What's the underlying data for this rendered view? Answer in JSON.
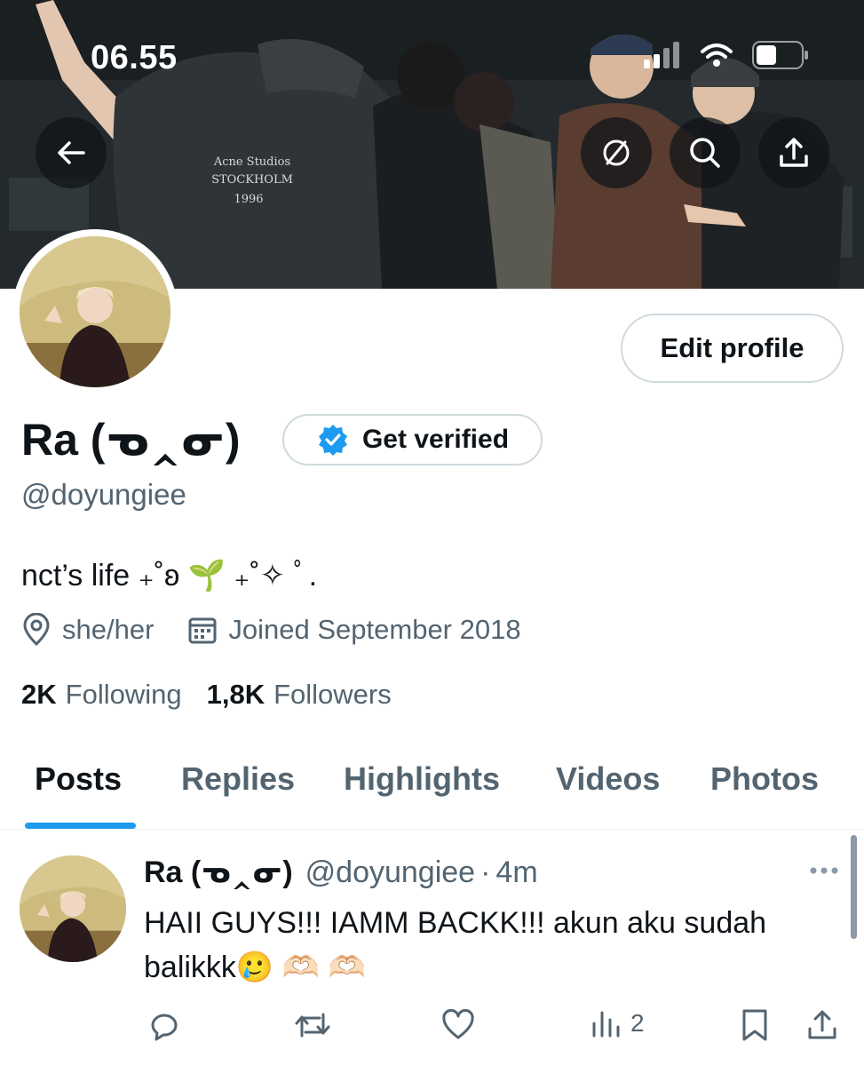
{
  "status_bar": {
    "time": "06.55"
  },
  "banner": {
    "shirt_text": [
      "Acne Studios",
      "STOCKHOLM",
      "1996"
    ]
  },
  "header_buttons": {
    "back": "arrow-left-icon",
    "grok": "slash-circle-icon",
    "search": "search-icon",
    "share": "share-icon"
  },
  "profile": {
    "edit_label": "Edit profile",
    "name": "Ra (ᓀ‸ᓂ)",
    "verify_label": "Get verified",
    "handle": "@doyungiee",
    "bio": "nct’s life ₊˚ʚ 🌱 ₊˚✧ ﾟ.",
    "location": "she/her",
    "joined": "Joined September 2018",
    "following_count": "2K",
    "following_label": "Following",
    "followers_count": "1,8K",
    "followers_label": "Followers"
  },
  "tabs": [
    {
      "label": "Posts",
      "active": true
    },
    {
      "label": "Replies",
      "active": false
    },
    {
      "label": "Highlights",
      "active": false
    },
    {
      "label": "Videos",
      "active": false
    },
    {
      "label": "Photos",
      "active": false
    }
  ],
  "post": {
    "name": "Ra (ᓀ‸ᓂ)",
    "handle": "@doyungiee",
    "separator": "·",
    "time": "4m",
    "text": "HAII GUYS!!! IAMM BACKK!!! akun aku sudah balikkk🥲 🫶🏻 🫶🏻",
    "views": "2"
  },
  "colors": {
    "accent": "#1d9bf0",
    "text_primary": "#0f1419",
    "text_secondary": "#536471",
    "border": "#cfd9de"
  }
}
